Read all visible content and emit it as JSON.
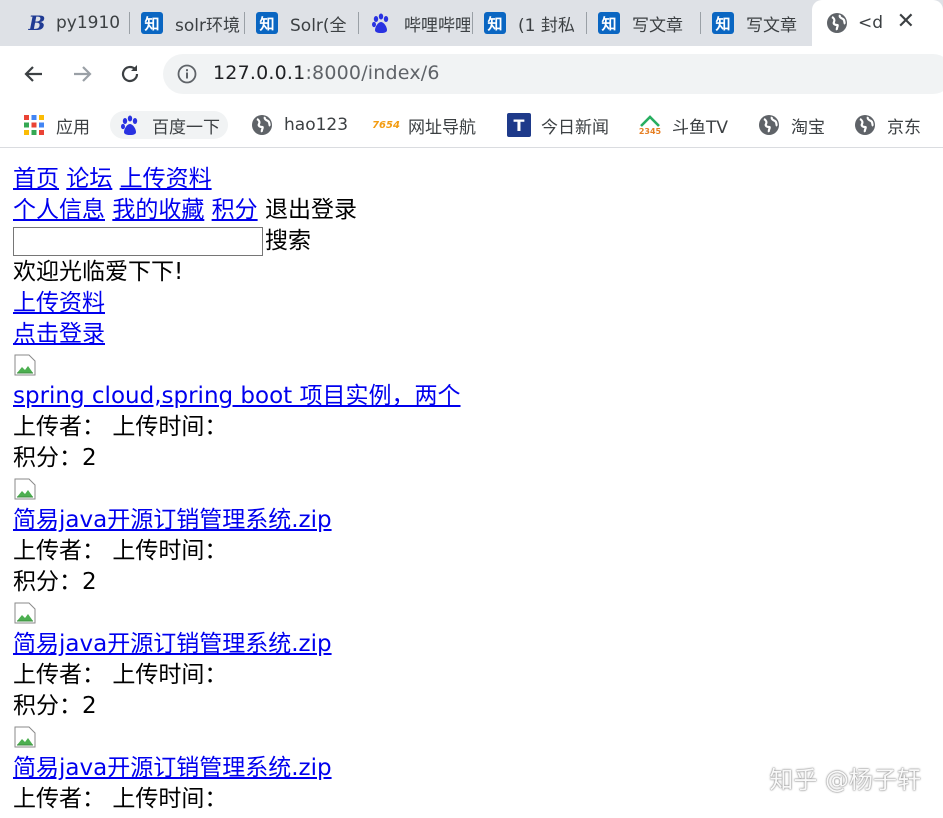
{
  "browser": {
    "tabs": [
      {
        "icon": "b-icon",
        "title": "py1910"
      },
      {
        "icon": "zhihu-icon",
        "title": "solr环境"
      },
      {
        "icon": "zhihu-icon",
        "title": "Solr(全"
      },
      {
        "icon": "baidu-paw-icon",
        "title": "哔哩哔哩"
      },
      {
        "icon": "zhihu-icon",
        "title": "(1 封私"
      },
      {
        "icon": "zhihu-icon",
        "title": "写文章"
      },
      {
        "icon": "zhihu-icon",
        "title": "写文章"
      },
      {
        "icon": "globe-icon",
        "title": "<d"
      }
    ],
    "zhi_glyph": "知",
    "close_glyph": "✕",
    "url_host": "127.0.0.1",
    "url_path": ":8000/index/6",
    "bookmarks": [
      {
        "icon": "apps-grid-icon",
        "label": "应用"
      },
      {
        "icon": "baidu-paw-icon",
        "label": "百度一下"
      },
      {
        "icon": "globe-icon",
        "label": "hao123"
      },
      {
        "icon": "7654-icon",
        "label": "网址导航",
        "badge": "7654"
      },
      {
        "icon": "toutiao-icon",
        "label": "今日新闻",
        "badge": "T"
      },
      {
        "icon": "2345-icon",
        "label": "斗鱼TV",
        "badge": "2345"
      },
      {
        "icon": "globe-icon",
        "label": "淘宝"
      },
      {
        "icon": "globe-icon",
        "label": "京东"
      }
    ]
  },
  "page": {
    "nav1": [
      "首页",
      "论坛",
      "上传资料"
    ],
    "nav2": [
      "个人信息",
      "我的收藏",
      "积分"
    ],
    "logout": "退出登录",
    "search_value": "",
    "search_button": "搜索",
    "welcome": "欢迎光临爱下下!",
    "upload_link": "上传资料",
    "login_link": "点击登录",
    "items": [
      {
        "title": "spring cloud,spring boot 项目实例，两个",
        "uploader_label": "上传者：",
        "time_label": "上传时间：",
        "points": "积分：2"
      },
      {
        "title": "简易java开源订销管理系统.zip",
        "uploader_label": "上传者：",
        "time_label": "上传时间：",
        "points": "积分：2"
      },
      {
        "title": "简易java开源订销管理系统.zip",
        "uploader_label": "上传者：",
        "time_label": "上传时间：",
        "points": "积分：2"
      },
      {
        "title": "简易java开源订销管理系统.zip",
        "uploader_label": "上传者：",
        "time_label": "上传时间：",
        "points": ""
      }
    ]
  },
  "watermark": "知乎 @杨子轩",
  "colors": {
    "link": "#0000ee",
    "tabstrip": "#dee1e6",
    "omnibox": "#f1f3f4",
    "zhihu": "#0a66c2"
  }
}
